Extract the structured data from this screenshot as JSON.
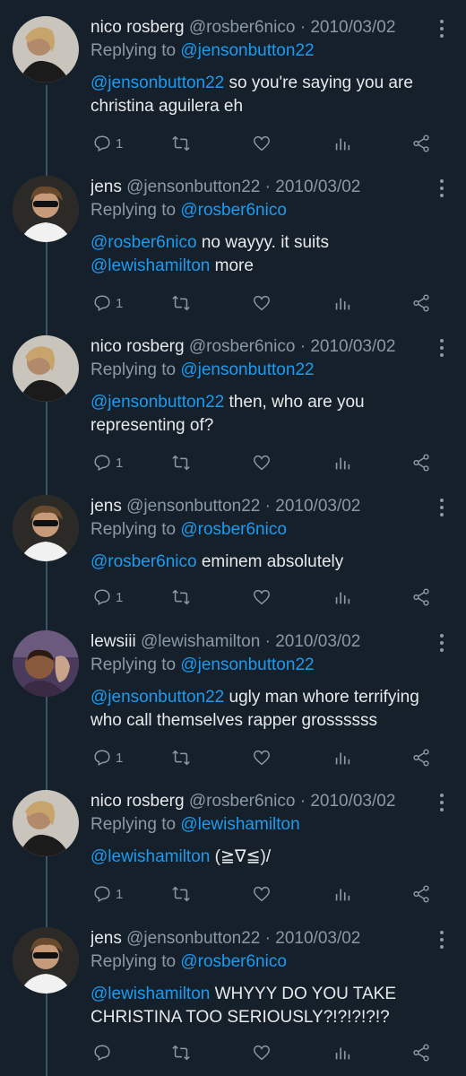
{
  "replying_prefix": "Replying to",
  "tweets": [
    {
      "name": "nico rosberg",
      "handle": "@rosber6nico",
      "sep": "·",
      "date": "2010/03/02",
      "reply_to": "@jensonbutton22",
      "mention": "@jensonbutton22",
      "text": " so you're saying you are christina aguilera eh",
      "reply_count": "1",
      "avatar": "nico"
    },
    {
      "name": "jens",
      "handle": "@jensonbutton22",
      "sep": "·",
      "date": "2010/03/02",
      "reply_to": "@rosber6nico",
      "mention": "@rosber6nico",
      "text": " no wayyy. it suits ",
      "mention2": "@lewishamilton",
      "text2": " more",
      "reply_count": "1",
      "avatar": "jens"
    },
    {
      "name": "nico rosberg",
      "handle": "@rosber6nico",
      "sep": "·",
      "date": "2010/03/02",
      "reply_to": "@jensonbutton22",
      "mention": "@jensonbutton22",
      "text": " then, who are you representing of?",
      "reply_count": "1",
      "avatar": "nico"
    },
    {
      "name": "jens",
      "handle": "@jensonbutton22",
      "sep": "·",
      "date": "2010/03/02",
      "reply_to": "@rosber6nico",
      "mention": "@rosber6nico",
      "text": " eminem absolutely",
      "reply_count": "1",
      "avatar": "jens"
    },
    {
      "name": "lewsiii",
      "handle": "@lewishamilton",
      "sep": "·",
      "date": "2010/03/02",
      "reply_to": "@jensonbutton22",
      "mention": "@jensonbutton22",
      "text": " ugly man whore terrifying who call themselves rapper grossssss",
      "reply_count": "1",
      "avatar": "lewis"
    },
    {
      "name": "nico rosberg",
      "handle": "@rosber6nico",
      "sep": "·",
      "date": "2010/03/02",
      "reply_to": "@lewishamilton",
      "mention": "@lewishamilton",
      "text": " (≧∇≦)/",
      "reply_count": "1",
      "avatar": "nico"
    },
    {
      "name": "jens",
      "handle": "@jensonbutton22",
      "sep": "·",
      "date": "2010/03/02",
      "reply_to": "@rosber6nico",
      "mention": "@lewishamilton",
      "text": " WHYYY DO YOU TAKE CHRISTINA TOO SERIOUSLY?!?!?!?!?",
      "reply_count": "",
      "avatar": "jens"
    }
  ],
  "icons": [
    "reply-icon",
    "retweet-icon",
    "like-icon",
    "analytics-icon",
    "share-icon",
    "more-icon"
  ],
  "colors": {
    "background": "#15202b",
    "text": "#e7e9ea",
    "muted": "#8b98a5",
    "link": "#1d9bf0"
  }
}
